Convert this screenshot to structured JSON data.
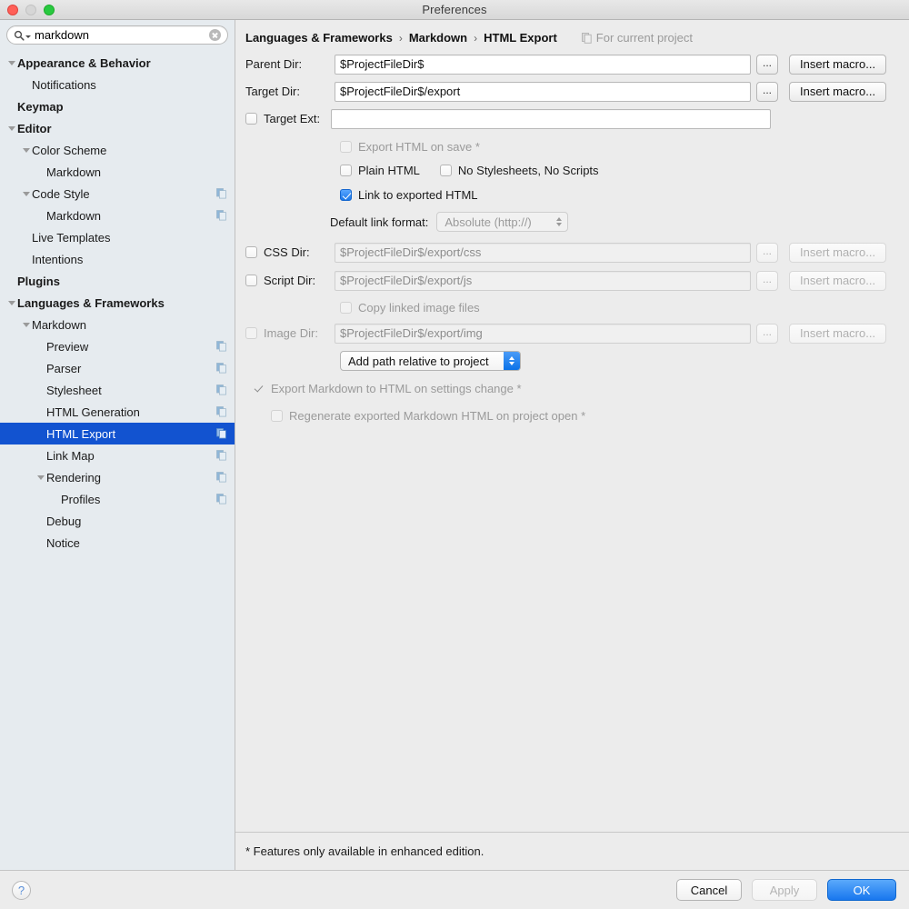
{
  "window": {
    "title": "Preferences",
    "traffic": {
      "close": "close-button",
      "minimize": "minimize-button",
      "zoom": "zoom-button"
    }
  },
  "sidebar": {
    "search": {
      "value": "markdown",
      "placeholder": "",
      "icon": "search-icon",
      "clear_icon": "clear-icon"
    },
    "items": [
      {
        "label": "Appearance & Behavior",
        "indent": 0,
        "bold": true,
        "twisty": "down",
        "badge": false,
        "selected": false
      },
      {
        "label": "Notifications",
        "indent": 1,
        "bold": false,
        "twisty": "",
        "badge": false,
        "selected": false
      },
      {
        "label": "Keymap",
        "indent": 0,
        "bold": true,
        "twisty": "",
        "badge": false,
        "selected": false
      },
      {
        "label": "Editor",
        "indent": 0,
        "bold": true,
        "twisty": "down",
        "badge": false,
        "selected": false
      },
      {
        "label": "Color Scheme",
        "indent": 1,
        "bold": false,
        "twisty": "down",
        "badge": false,
        "selected": false
      },
      {
        "label": "Markdown",
        "indent": 2,
        "bold": false,
        "twisty": "",
        "badge": false,
        "selected": false
      },
      {
        "label": "Code Style",
        "indent": 1,
        "bold": false,
        "twisty": "down",
        "badge": true,
        "selected": false
      },
      {
        "label": "Markdown",
        "indent": 2,
        "bold": false,
        "twisty": "",
        "badge": true,
        "selected": false
      },
      {
        "label": "Live Templates",
        "indent": 1,
        "bold": false,
        "twisty": "",
        "badge": false,
        "selected": false
      },
      {
        "label": "Intentions",
        "indent": 1,
        "bold": false,
        "twisty": "",
        "badge": false,
        "selected": false
      },
      {
        "label": "Plugins",
        "indent": 0,
        "bold": true,
        "twisty": "",
        "badge": false,
        "selected": false
      },
      {
        "label": "Languages & Frameworks",
        "indent": 0,
        "bold": true,
        "twisty": "down",
        "badge": false,
        "selected": false
      },
      {
        "label": "Markdown",
        "indent": 1,
        "bold": false,
        "twisty": "down",
        "badge": false,
        "selected": false
      },
      {
        "label": "Preview",
        "indent": 2,
        "bold": false,
        "twisty": "",
        "badge": true,
        "selected": false
      },
      {
        "label": "Parser",
        "indent": 2,
        "bold": false,
        "twisty": "",
        "badge": true,
        "selected": false
      },
      {
        "label": "Stylesheet",
        "indent": 2,
        "bold": false,
        "twisty": "",
        "badge": true,
        "selected": false
      },
      {
        "label": "HTML Generation",
        "indent": 2,
        "bold": false,
        "twisty": "",
        "badge": true,
        "selected": false
      },
      {
        "label": "HTML Export",
        "indent": 2,
        "bold": false,
        "twisty": "",
        "badge": true,
        "selected": true
      },
      {
        "label": "Link Map",
        "indent": 2,
        "bold": false,
        "twisty": "",
        "badge": true,
        "selected": false
      },
      {
        "label": "Rendering",
        "indent": 2,
        "bold": false,
        "twisty": "down",
        "badge": true,
        "selected": false
      },
      {
        "label": "Profiles",
        "indent": 3,
        "bold": false,
        "twisty": "",
        "badge": true,
        "selected": false
      },
      {
        "label": "Debug",
        "indent": 2,
        "bold": false,
        "twisty": "",
        "badge": false,
        "selected": false
      },
      {
        "label": "Notice",
        "indent": 2,
        "bold": false,
        "twisty": "",
        "badge": false,
        "selected": false
      }
    ]
  },
  "main": {
    "breadcrumb": {
      "crumb1": "Languages & Frameworks",
      "sep1": "›",
      "crumb2": "Markdown",
      "sep2": "›",
      "crumb3": "HTML Export",
      "scope_label": "For current project",
      "scope_icon": "project-badge-icon"
    },
    "parent_dir": {
      "label": "Parent Dir:",
      "value": "$ProjectFileDir$",
      "browse_label": "...",
      "macro_label": "Insert macro..."
    },
    "target_dir": {
      "label": "Target Dir:",
      "value": "$ProjectFileDir$/export",
      "browse_label": "...",
      "macro_label": "Insert macro..."
    },
    "target_ext": {
      "label": "Target Ext:",
      "value": "",
      "checked": false
    },
    "export_on_save": {
      "label": "Export HTML on save *",
      "checked": false,
      "enabled": false
    },
    "plain_html": {
      "label": "Plain HTML",
      "checked": false,
      "enabled": true
    },
    "no_styles_no_scripts": {
      "label": "No Stylesheets, No Scripts",
      "checked": false,
      "enabled": true
    },
    "link_to_exported": {
      "label": "Link to exported HTML",
      "checked": true,
      "enabled": true
    },
    "default_link_format": {
      "label": "Default link format:",
      "value": "Absolute (http://)",
      "enabled": false,
      "options": [
        "Absolute (http://)"
      ]
    },
    "css_dir": {
      "label": "CSS Dir:",
      "value": "$ProjectFileDir$/export/css",
      "checked": false,
      "browse_label": "...",
      "macro_label": "Insert macro..."
    },
    "script_dir": {
      "label": "Script Dir:",
      "value": "$ProjectFileDir$/export/js",
      "checked": false,
      "browse_label": "...",
      "macro_label": "Insert macro..."
    },
    "copy_linked_images": {
      "label": "Copy linked image files",
      "checked": false,
      "enabled": false
    },
    "image_dir": {
      "label": "Image Dir:",
      "value": "$ProjectFileDir$/export/img",
      "checked": false,
      "browse_label": "...",
      "macro_label": "Insert macro..."
    },
    "path_mode": {
      "value": "Add path relative to project",
      "enabled": true,
      "options": [
        "Add path relative to project"
      ]
    },
    "export_on_settings_change": {
      "label": "Export Markdown to HTML on settings change *",
      "checked": true,
      "enabled": false
    },
    "regenerate_on_open": {
      "label": "Regenerate exported Markdown HTML on project open *",
      "checked": false,
      "enabled": false
    },
    "footnote": "* Features only available in enhanced edition."
  },
  "footer": {
    "help_label": "?",
    "cancel_label": "Cancel",
    "apply_label": "Apply",
    "ok_label": "OK"
  },
  "colors": {
    "selection_blue": "#1253d0",
    "primary_button": "#1877ee",
    "checkbox_on": "#1a77e8",
    "sidebar_bg": "#e6ebef",
    "pane_bg": "#ececec"
  }
}
